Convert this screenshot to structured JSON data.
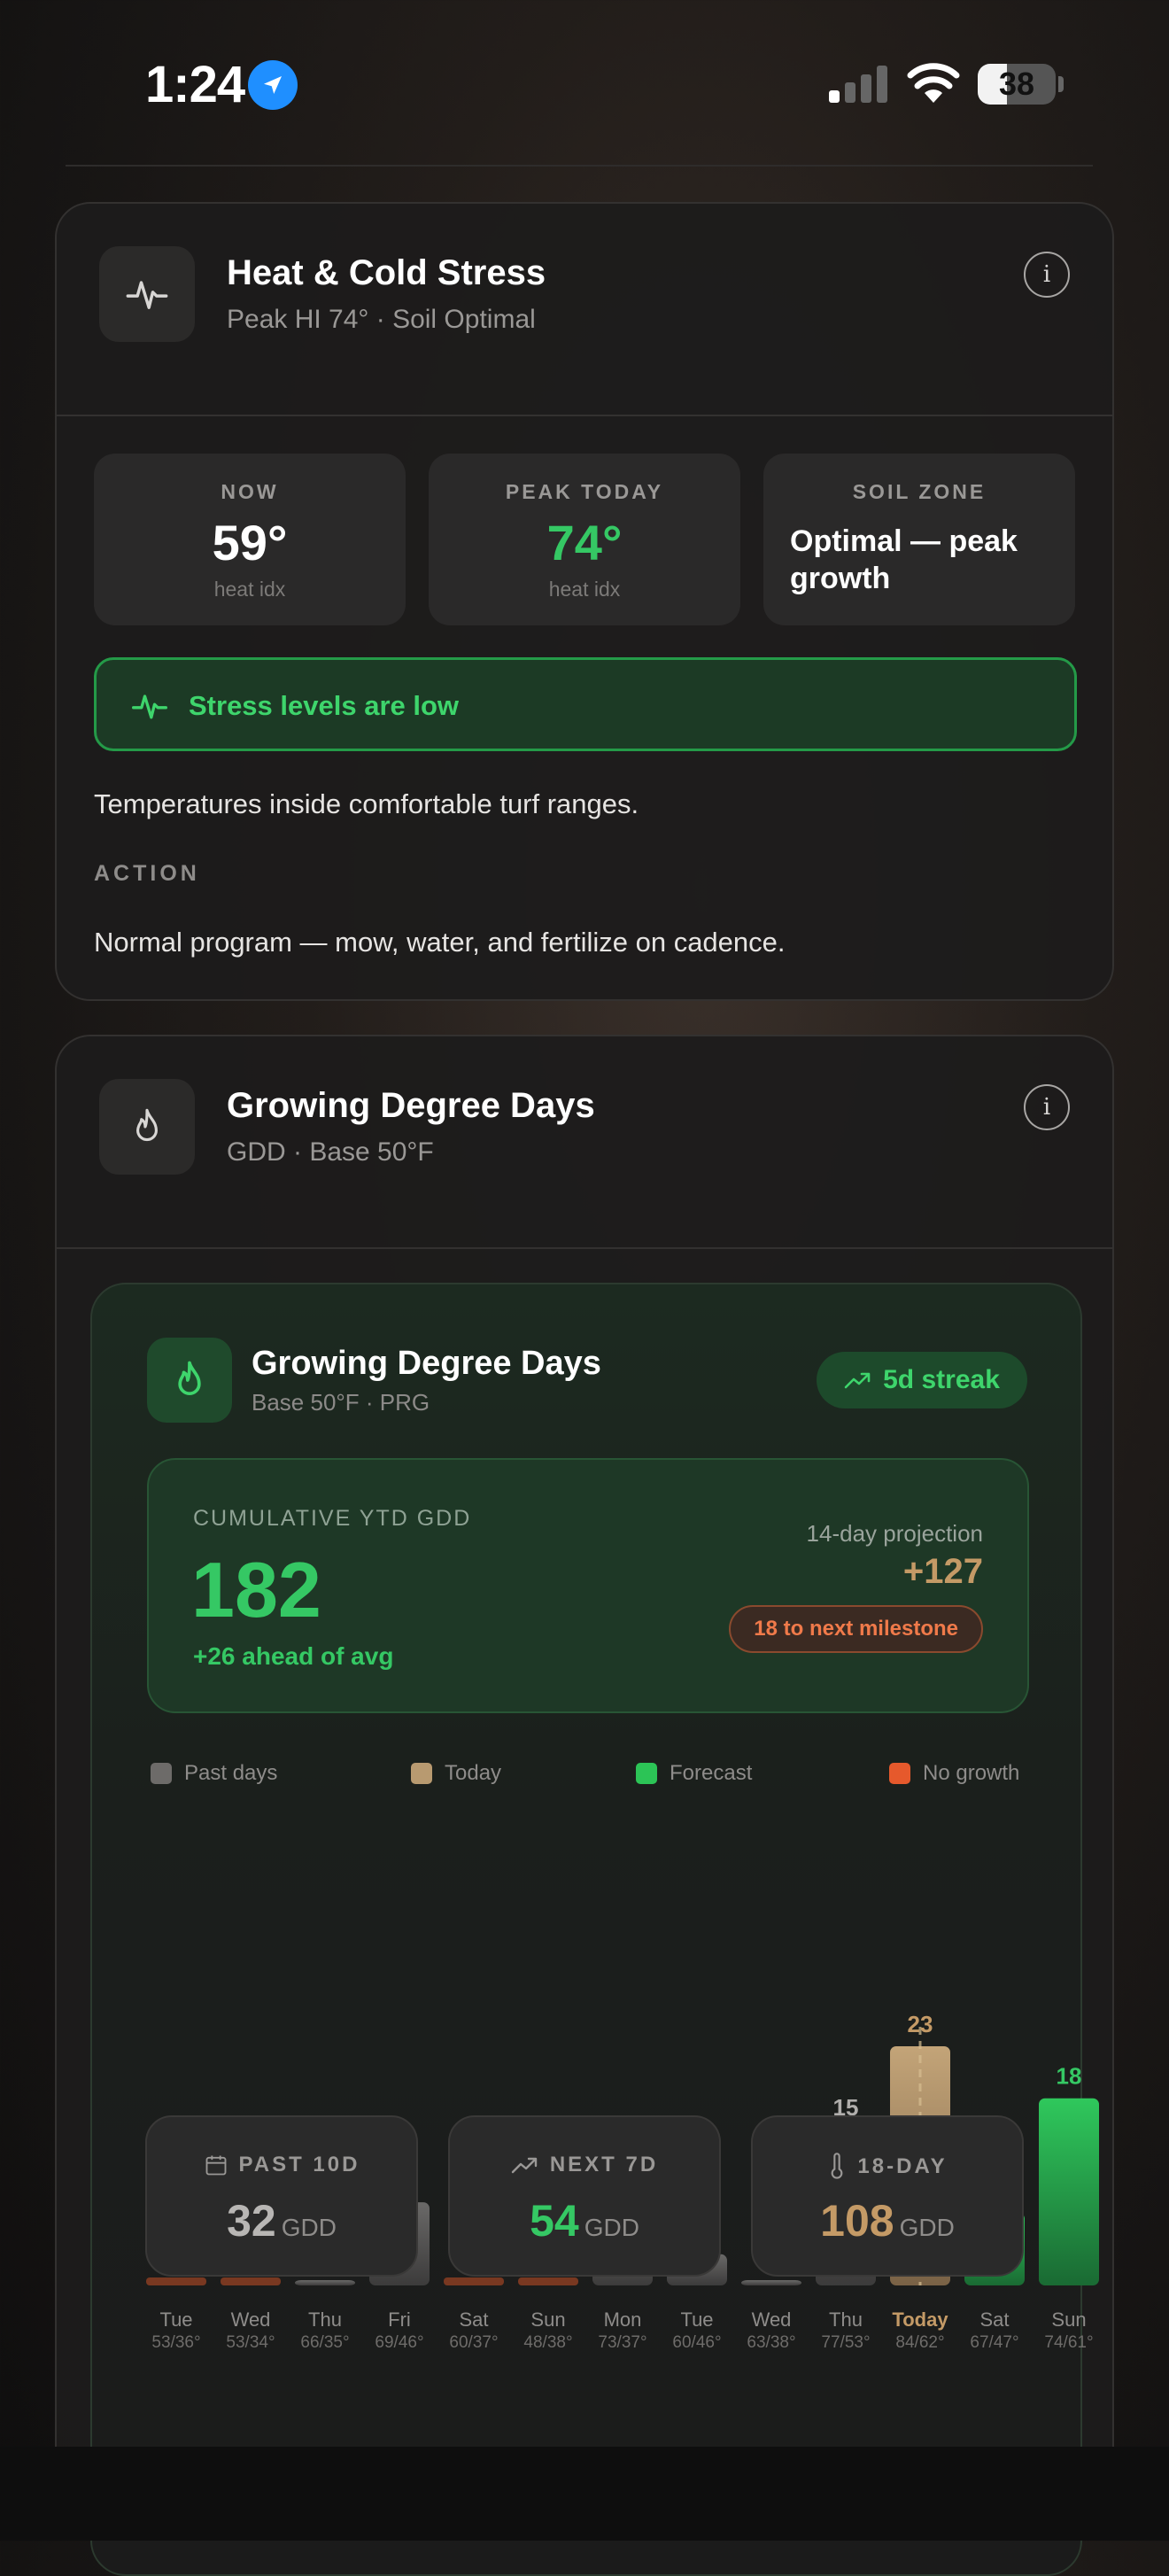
{
  "status_bar": {
    "time": "1:24",
    "battery": "38"
  },
  "heat_card": {
    "title": "Heat & Cold Stress",
    "subtitle": "Peak HI 74° · Soil Optimal",
    "tiles": [
      {
        "label": "NOW",
        "value": "59°",
        "unit": "heat idx"
      },
      {
        "label": "PEAK TODAY",
        "value": "74°",
        "unit": "heat idx"
      },
      {
        "label": "SOIL ZONE",
        "value": "Optimal — peak growth"
      }
    ],
    "banner": "Stress levels are low",
    "description": "Temperatures inside comfortable turf ranges.",
    "action_label": "ACTION",
    "action_text": "Normal program — mow, water, and fertilize on cadence."
  },
  "gdd_card": {
    "title": "Growing Degree Days",
    "subtitle": "GDD · Base 50°F",
    "inner": {
      "title": "Growing Degree Days",
      "subtitle": "Base 50°F · PRG",
      "streak": "5d streak",
      "ytd_label": "CUMULATIVE YTD GDD",
      "ytd_value": "182",
      "ytd_ahead": "+26 ahead of avg",
      "projection_label": "14-day projection",
      "projection_value": "+127",
      "milestone": "18 to next milestone"
    },
    "legend": [
      {
        "label": "Past days",
        "color": "#6d6b69"
      },
      {
        "label": "Today",
        "color": "#b89a70"
      },
      {
        "label": "Forecast",
        "color": "#2cc456"
      },
      {
        "label": "No growth",
        "color": "#e6592c"
      }
    ],
    "stats": [
      {
        "label": "PAST 10D",
        "value": "32",
        "unit": "GDD",
        "color": "#b8b6b4",
        "icon": "calendar-icon"
      },
      {
        "label": "NEXT 7D",
        "value": "54",
        "unit": "GDD",
        "color": "#35c864",
        "icon": "trend-up-icon"
      },
      {
        "label": "18-DAY",
        "value": "108",
        "unit": "GDD",
        "color": "#c49a66",
        "icon": "thermometer-icon"
      }
    ]
  },
  "chart_data": {
    "type": "bar",
    "categories": [
      "Tue",
      "Wed",
      "Thu",
      "Fri",
      "Sat",
      "Sun",
      "Mon",
      "Tue",
      "Wed",
      "Thu",
      "Today",
      "Sat",
      "Sun"
    ],
    "temps": [
      "53/36°",
      "53/34°",
      "66/35°",
      "69/46°",
      "60/37°",
      "48/38°",
      "73/37°",
      "60/46°",
      "63/38°",
      "77/53°",
      "84/62°",
      "67/47°",
      "74/61°"
    ],
    "values": [
      0,
      0,
      0,
      8,
      0,
      0,
      5,
      3,
      0,
      15,
      23,
      7,
      18
    ],
    "value_labels": [
      "",
      "",
      "",
      "8",
      "",
      "",
      "5",
      "3",
      "",
      "15",
      "23",
      "7",
      "18"
    ],
    "kind": [
      "none",
      "none",
      "past",
      "past",
      "none",
      "none",
      "past",
      "past",
      "past",
      "past",
      "today",
      "forecast",
      "forecast"
    ],
    "ylim": [
      0,
      23
    ]
  }
}
